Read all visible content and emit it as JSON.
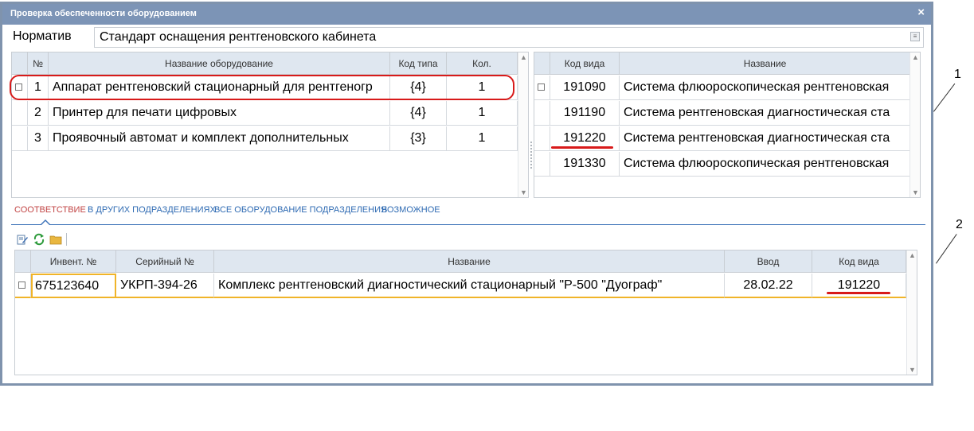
{
  "window": {
    "title": "Проверка обеспеченности оборудованием",
    "close_glyph": "×"
  },
  "norm": {
    "label": "Норматив",
    "value": "Стандарт оснащения рентгеновского кабинета"
  },
  "left_grid": {
    "headers": {
      "num": "№",
      "name": "Название оборудование",
      "type_code": "Код типа",
      "qty": "Кол."
    },
    "rows": [
      {
        "num": "1",
        "name": "Аппарат рентгеновский стационарный для рентгеногр",
        "type_code": "{4}",
        "qty": "1"
      },
      {
        "num": "2",
        "name": "Принтер для печати цифровых",
        "type_code": "{4}",
        "qty": "1"
      },
      {
        "num": "3",
        "name": "Проявочный автомат и комплект дополнительных",
        "type_code": "{3}",
        "qty": "1"
      }
    ]
  },
  "right_grid": {
    "headers": {
      "code": "Код вида",
      "name": "Название"
    },
    "rows": [
      {
        "code": "191090",
        "name": "Система флюороскопическая рентгеновская"
      },
      {
        "code": "191190",
        "name": "Система рентгеновская диагностическая ста"
      },
      {
        "code": "191220",
        "name": "Система рентгеновская диагностическая ста"
      },
      {
        "code": "191330",
        "name": "Система флюороскопическая рентгеновская"
      }
    ]
  },
  "tabs": [
    {
      "label": "СООТВЕТСТВИЕ",
      "active": true
    },
    {
      "label": "В ДРУГИХ ПОДРАЗДЕЛЕНИЯХ",
      "active": false
    },
    {
      "label": "ВСЕ ОБОРУДОВАНИЕ ПОДРАЗДЕЛЕНИЯ",
      "active": false
    },
    {
      "label": "ВОЗМОЖНОЕ",
      "active": false
    }
  ],
  "toolbar": {
    "icons": [
      "edit-icon",
      "refresh-icon",
      "folder-icon"
    ]
  },
  "bottom_grid": {
    "headers": {
      "inv": "Инвент. №",
      "serial": "Серийный №",
      "name": "Название",
      "date": "Ввод",
      "code": "Код вида"
    },
    "rows": [
      {
        "inv": "675123640",
        "serial": "УКРП-394-26",
        "name": "Комплекс рентгеновский диагностический стационарный \"Р-500 \"Дуограф\"",
        "date": "28.02.22",
        "code": "191220"
      }
    ]
  },
  "annotations": {
    "one": "1",
    "two": "2"
  },
  "colors": {
    "accent": "#7c94b6",
    "header_bg": "#dfe7f0",
    "highlight": "#d81a1a",
    "tab_active": "#c24545",
    "tab_link": "#2f6bb3"
  }
}
